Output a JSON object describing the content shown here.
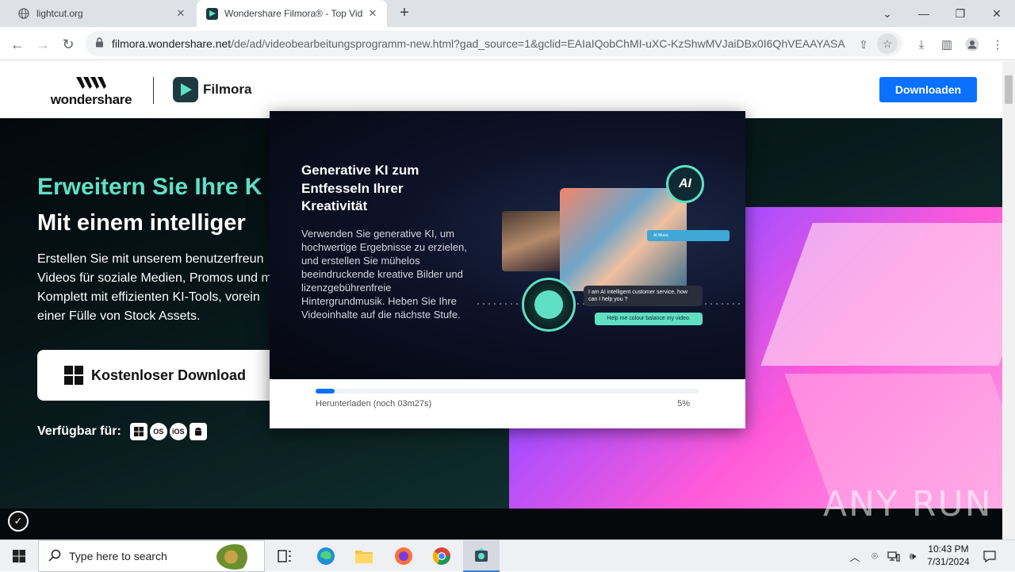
{
  "browser": {
    "tabs": [
      {
        "title": "lightcut.org",
        "icon": "globe-icon"
      },
      {
        "title": "Wondershare Filmora® - Top Vid",
        "icon": "filmora-favicon-icon"
      }
    ],
    "new_tab": "+",
    "url_host": "filmora.wondershare.net",
    "url_rest": "/de/ad/videobearbeitungsprogramm-new.html?gad_source=1&gclid=EAIaIQobChMI-uXC-KzShwMVJaiDBx0I6QhVEAAYASAA..."
  },
  "site": {
    "brand": "wondershare",
    "product": "Filmora",
    "download_button": "Downloaden",
    "hero": {
      "headline": "Erweitern Sie Ihre K",
      "subheadline": "Mit einem intelliger",
      "body": "Erstellen Sie mit unserem benutzerfreun\nVideos für soziale Medien, Promos und m\nKomplett mit effizienten KI-Tools, vorein\neiner Fülle von Stock Assets.",
      "cta": "Kostenloser Download",
      "available_label": "Verfügbar für:",
      "platforms": [
        "windows",
        "macOS",
        "iOS",
        "android"
      ]
    }
  },
  "modal": {
    "title": "Generative KI zum Entfesseln Ihrer Kreativität",
    "description": "Verwenden Sie generative KI, um hochwertige Ergebnisse zu erzielen, und erstellen Sie mühelos beeindruckende kreative Bilder und lizenzgebührenfreie Hintergrundmusik. Heben Sie Ihre Videoinhalte auf die nächste Stufe.",
    "ai_badge": "AI",
    "chat_bot": "I am AI intelligent customer service, how can I help you ?",
    "chat_user": "Help me colour balance my video.",
    "hud_label": "AI Music",
    "status": "Herunterladen (noch 03m27s)",
    "progress_percent": 5,
    "progress_label": "5%"
  },
  "watermark": "ANY RUN",
  "taskbar": {
    "search_placeholder": "Type here to search",
    "time": "10:43 PM",
    "date": "7/31/2024"
  },
  "colors": {
    "accent": "#0a70ff",
    "brand_teal": "#5fe0c5"
  }
}
